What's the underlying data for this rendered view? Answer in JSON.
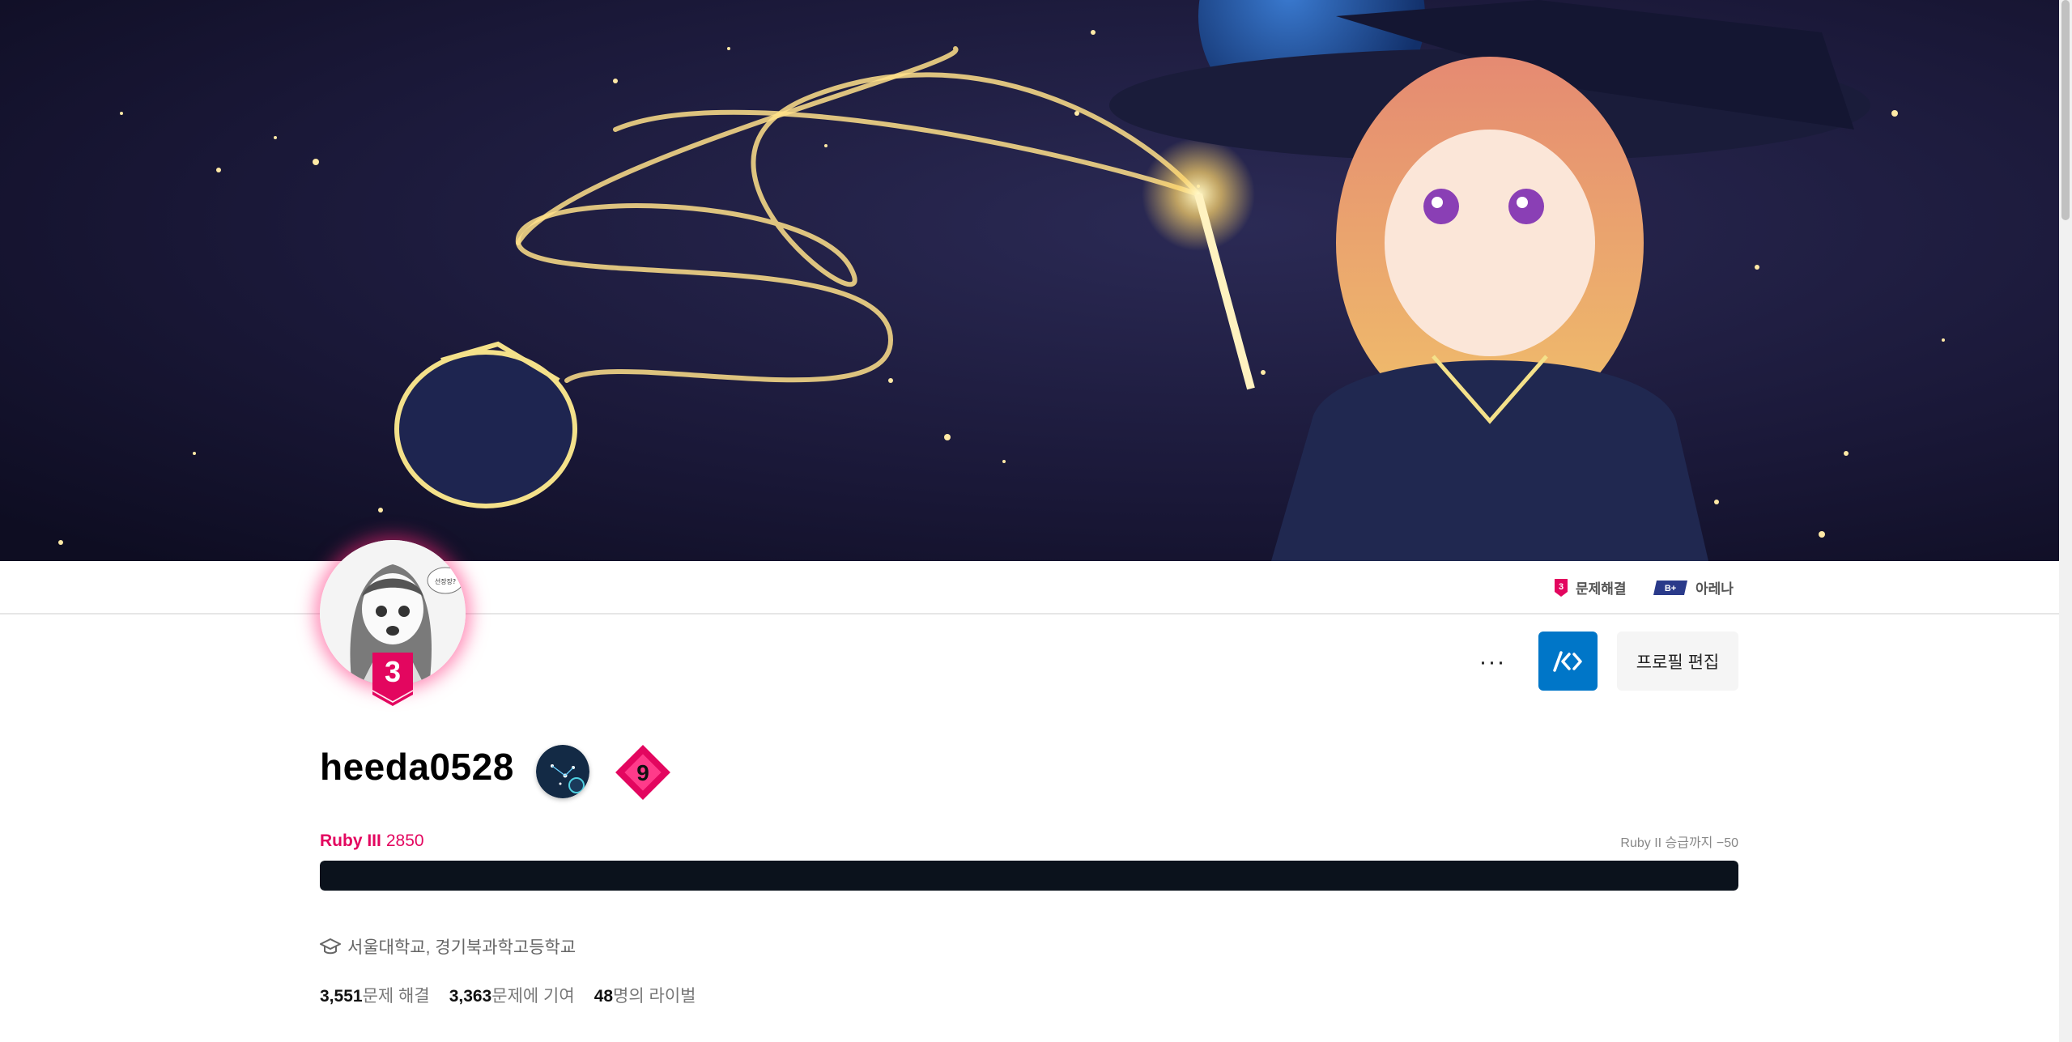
{
  "tier_strip": {
    "problem_solving": {
      "badge": "3",
      "label": "문제해결",
      "color": "#e3065f"
    },
    "arena": {
      "badge": "B+",
      "label": "아레나",
      "color": "#2a3a8a"
    }
  },
  "avatar": {
    "speech_text": "선장장?"
  },
  "tier_badge_number": "3",
  "actions": {
    "more_label": "···",
    "edit_profile_label": "프로필 편집"
  },
  "profile": {
    "username": "heeda0528",
    "diamond_badge_number": "9"
  },
  "rating": {
    "tier": "Ruby III",
    "value": "2850",
    "next_promotion": "Ruby II 승급까지 −50",
    "progress_fraction": 1.0
  },
  "school": {
    "icon": "graduation-cap-icon",
    "text": "서울대학교, 경기북과학고등학교"
  },
  "stats": {
    "solved_count": "3,551",
    "solved_label": "문제 해결",
    "contributed_count": "3,363",
    "contributed_label": "문제에 기여",
    "rivals_count": "48",
    "rivals_label": "명의 라이벌"
  },
  "colors": {
    "ruby": "#e3065f",
    "primary_button": "#0076c8",
    "progress": "#0b121c"
  }
}
